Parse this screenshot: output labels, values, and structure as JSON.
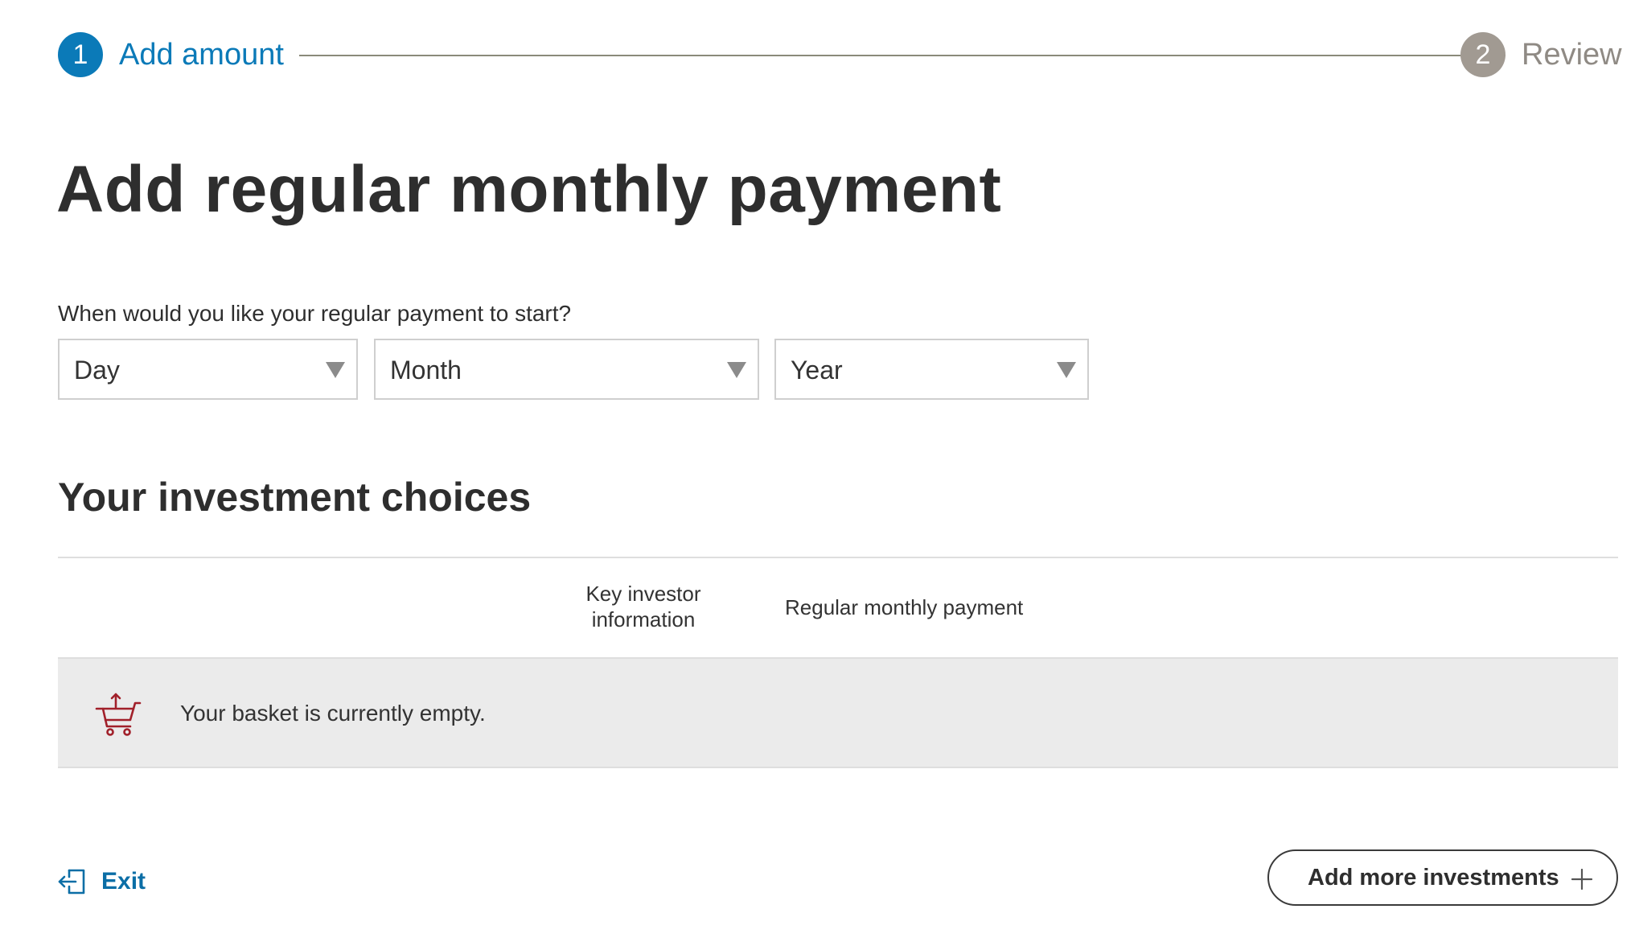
{
  "stepper": {
    "steps": [
      {
        "number": "1",
        "label": "Add amount",
        "state": "active"
      },
      {
        "number": "2",
        "label": "Review",
        "state": "inactive"
      }
    ]
  },
  "title": "Add regular monthly payment",
  "start_date": {
    "question": "When would you like your regular payment to start?",
    "day": {
      "value": "Day"
    },
    "month": {
      "value": "Month"
    },
    "year": {
      "value": "Year"
    }
  },
  "investments": {
    "heading": "Your investment choices",
    "columns": {
      "kii": "Key investor information",
      "payment": "Regular monthly payment"
    },
    "empty_message": "Your basket is currently empty."
  },
  "footer": {
    "exit_label": "Exit",
    "add_more_label": "Add more investments"
  },
  "icons": {
    "basket": "shopping-basket-icon",
    "exit": "exit-icon",
    "add": "plus-icon",
    "dropdown": "chevron-down-icon"
  },
  "colors": {
    "accent": "#0b7ab8",
    "inactive_step": "#a19a92",
    "basket_icon": "#a1202a",
    "link": "#0b6ea6",
    "empty_row_bg": "#ebebeb"
  }
}
